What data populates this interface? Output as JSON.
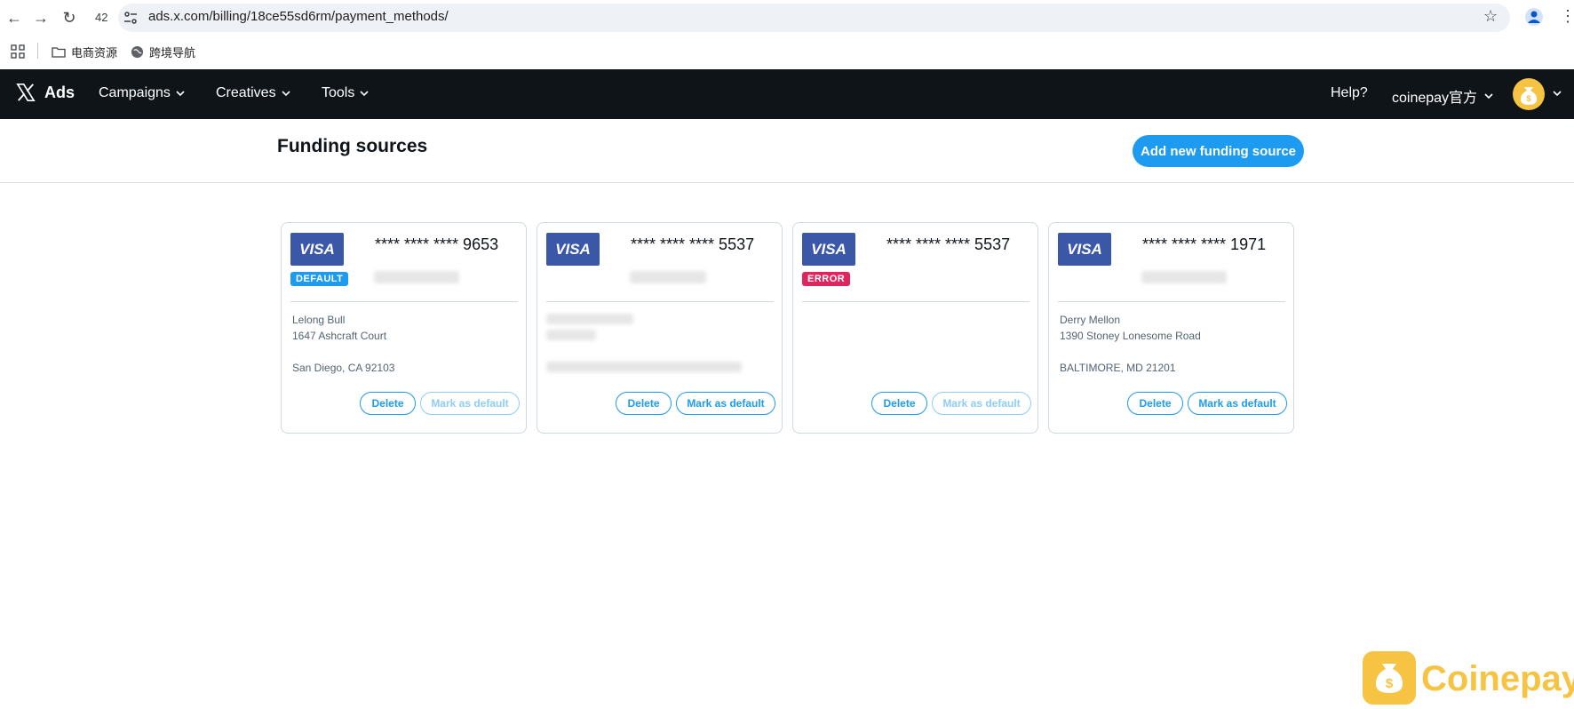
{
  "browser": {
    "tab_count": "42",
    "url": "ads.x.com/billing/18ce55sd6rm/payment_methods/",
    "bookmarks": [
      "电商资源",
      "跨境导航"
    ]
  },
  "header": {
    "brand": "Ads",
    "nav": [
      "Campaigns",
      "Creatives",
      "Tools"
    ],
    "help": "Help?",
    "account": "coinepay官方"
  },
  "page": {
    "title": "Funding sources",
    "add_button": "Add new funding source"
  },
  "cards": [
    {
      "brand": "VISA",
      "number": "**** **** **** 9653",
      "badge": "DEFAULT",
      "address": [
        "Lelong Bull",
        "1647 Ashcraft Court",
        "San Diego, CA 92103"
      ],
      "delete": "Delete",
      "mark_default": "Mark as default",
      "mark_default_enabled": false
    },
    {
      "brand": "VISA",
      "number": "**** **** **** 5537",
      "badge": "",
      "address": [
        "",
        "",
        ""
      ],
      "delete": "Delete",
      "mark_default": "Mark as default",
      "mark_default_enabled": true
    },
    {
      "brand": "VISA",
      "number": "**** **** **** 5537",
      "badge": "ERROR",
      "address": [
        "",
        "",
        ""
      ],
      "delete": "Delete",
      "mark_default": "Mark as default",
      "mark_default_enabled": false
    },
    {
      "brand": "VISA",
      "number": "**** **** **** 1971",
      "badge": "",
      "address": [
        "Derry Mellon",
        "1390 Stoney Lonesome Road",
        "BALTIMORE, MD 21201"
      ],
      "delete": "Delete",
      "mark_default": "Mark as default",
      "mark_default_enabled": true
    }
  ],
  "watermark": "Coinepay",
  "colors": {
    "header_bg": "#0f1419",
    "accent": "#1d9bf0",
    "visa_blue": "#3a57a8",
    "error": "#e0245e",
    "watermark": "#f6c343"
  }
}
